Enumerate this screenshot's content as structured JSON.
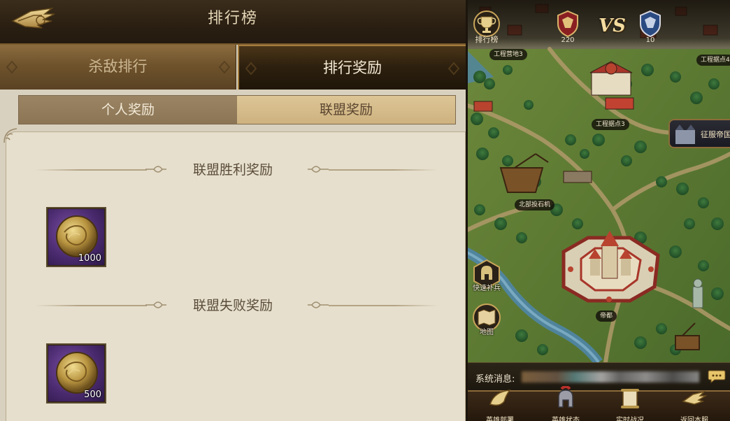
{
  "left": {
    "title": "排行榜",
    "tabs": [
      {
        "label": "杀敌排行",
        "active": false
      },
      {
        "label": "排行奖励",
        "active": true
      }
    ],
    "subtabs": [
      {
        "label": "个人奖励",
        "active": true
      },
      {
        "label": "联盟奖励",
        "active": false
      }
    ],
    "sections": [
      {
        "title": "联盟胜利奖励",
        "items": [
          {
            "icon": "gold-coin-icon",
            "quantity": "1000"
          }
        ]
      },
      {
        "title": "联盟失败奖励",
        "items": [
          {
            "icon": "gold-coin-icon",
            "quantity": "500"
          }
        ]
      }
    ]
  },
  "right": {
    "rank_button_label": "排行榜",
    "vs_label": "VS",
    "left_emblem_score": "220",
    "right_emblem_score": "10",
    "map_labels": [
      "工程营地3",
      "工程据点4",
      "工程据点3",
      "北部投石机",
      "帝都"
    ],
    "conquer_label": "征服帝国",
    "side_buttons": [
      {
        "label": "快速补兵",
        "icon": "helmet-icon"
      },
      {
        "label": "地图",
        "icon": "map-icon"
      }
    ],
    "system_message_label": "系统消息:",
    "bottom_nav": [
      {
        "label": "英雄部署",
        "icon": "horn-icon"
      },
      {
        "label": "英雄状态",
        "icon": "helmet-icon"
      },
      {
        "label": "实时战况",
        "icon": "scroll-icon"
      },
      {
        "label": "返回本服",
        "icon": "wing-icon"
      }
    ]
  },
  "colors": {
    "header_bg": "#2a1f12",
    "parchment": "#e6dfcd",
    "active_tab_text": "#f4ead4",
    "item_bg": "#4a2a6e",
    "map_grass": "#4f6b2f"
  }
}
